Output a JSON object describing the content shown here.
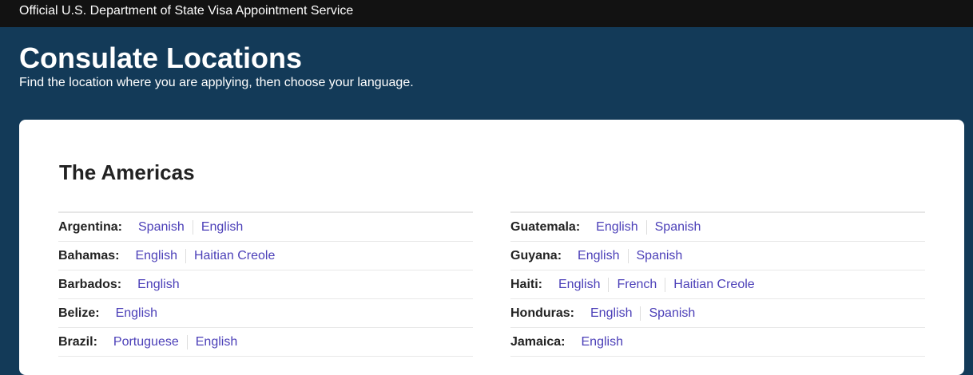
{
  "topbar": {
    "title": "Official U.S. Department of State Visa Appointment Service"
  },
  "hero": {
    "title": "Consulate Locations",
    "subtitle": "Find the location where you are applying, then choose your language."
  },
  "region": {
    "title": "The Americas",
    "left": [
      {
        "country": "Argentina:",
        "languages": [
          "Spanish",
          "English"
        ]
      },
      {
        "country": "Bahamas:",
        "languages": [
          "English",
          "Haitian Creole"
        ]
      },
      {
        "country": "Barbados:",
        "languages": [
          "English"
        ]
      },
      {
        "country": "Belize:",
        "languages": [
          "English"
        ]
      },
      {
        "country": "Brazil:",
        "languages": [
          "Portuguese",
          "English"
        ]
      }
    ],
    "right": [
      {
        "country": "Guatemala:",
        "languages": [
          "English",
          "Spanish"
        ]
      },
      {
        "country": "Guyana:",
        "languages": [
          "English",
          "Spanish"
        ]
      },
      {
        "country": "Haiti:",
        "languages": [
          "English",
          "French",
          "Haitian Creole"
        ]
      },
      {
        "country": "Honduras:",
        "languages": [
          "English",
          "Spanish"
        ]
      },
      {
        "country": "Jamaica:",
        "languages": [
          "English"
        ]
      }
    ]
  },
  "colors": {
    "link": "#4b3fb8",
    "hero_bg": "#133a58",
    "topbar_bg": "#121212"
  }
}
